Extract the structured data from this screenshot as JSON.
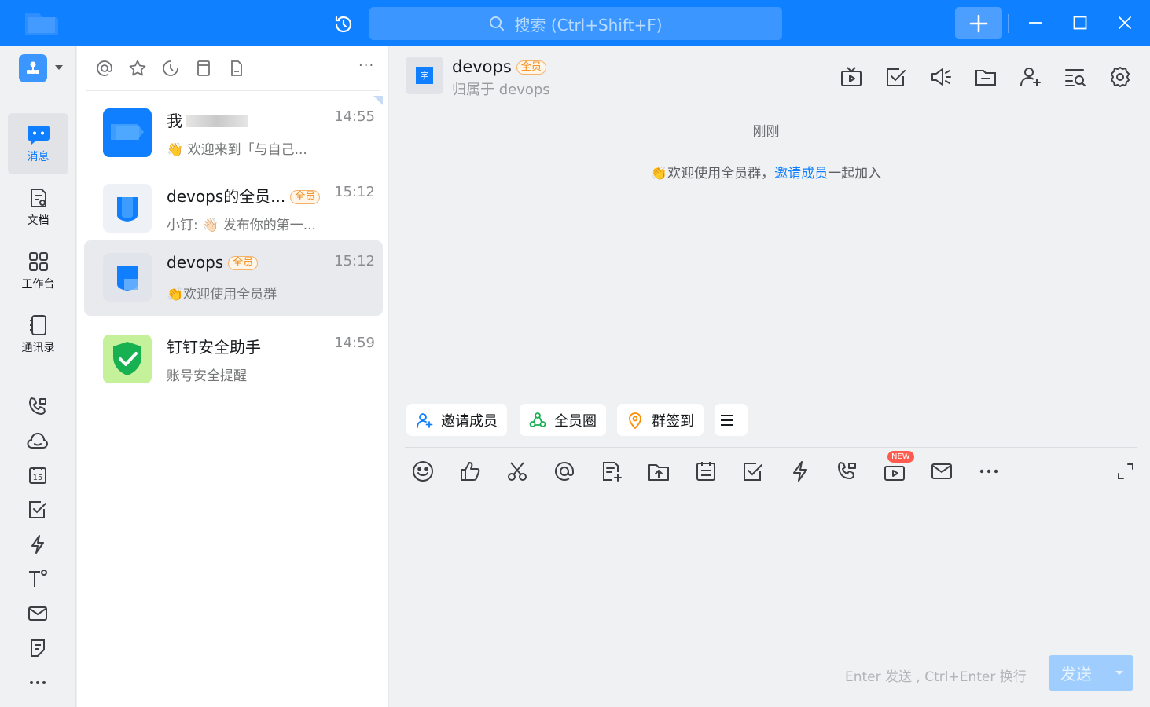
{
  "titlebar": {
    "search_placeholder": "搜索 (Ctrl+Shift+F)",
    "icons": [
      "app-logo",
      "history-icon",
      "search-icon",
      "plus-icon",
      "minimize-icon",
      "maximize-icon",
      "close-icon"
    ],
    "accent_color": "#0f80ff"
  },
  "nav": {
    "items": [
      {
        "label": "消息",
        "icon": "message-icon",
        "active": true
      },
      {
        "label": "文档",
        "icon": "document-icon",
        "active": false
      },
      {
        "label": "工作台",
        "icon": "workbench-icon",
        "active": false
      },
      {
        "label": "通讯录",
        "icon": "contacts-icon",
        "active": false
      }
    ],
    "secondary_icons": [
      "phone-icon",
      "cloud-icon",
      "calendar-icon",
      "todo-icon",
      "flash-icon",
      "text-tool-icon",
      "mail-icon",
      "notes-icon",
      "more-icon"
    ],
    "calendar_day": "15"
  },
  "list": {
    "filter_icons": [
      "at-icon",
      "star-icon",
      "clock-icon",
      "bookmark-icon",
      "file-icon"
    ],
    "more": "···",
    "conversations": [
      {
        "name": "我",
        "preview": "👋 欢迎来到「与自己...",
        "time": "14:55",
        "tag": "",
        "selected": false
      },
      {
        "name": "devops的全员...",
        "preview": "小钉: 👋🏻 发布你的第一...",
        "time": "15:12",
        "tag": "全员",
        "selected": false
      },
      {
        "name": "devops",
        "preview": "👏欢迎使用全员群",
        "time": "15:12",
        "tag": "全员",
        "selected": true
      },
      {
        "name": "钉钉安全助手",
        "preview": "账号安全提醒",
        "time": "14:59",
        "tag": "",
        "selected": false
      }
    ]
  },
  "chat": {
    "title": "devops",
    "tag": "全员",
    "subtitle": "归属于 devops",
    "group_avatar_char": "字",
    "header_icons": [
      "live-icon",
      "task-icon",
      "announcement-icon",
      "folder-icon",
      "add-member-icon",
      "search-history-icon",
      "settings-icon"
    ],
    "timestamp": "刚刚",
    "system_message": {
      "prefix": "👏欢迎使用全员群，",
      "link": "邀请成员",
      "suffix": "一起加入"
    },
    "quick_actions": [
      {
        "label": "邀请成员",
        "icon": "invite-icon"
      },
      {
        "label": "全员圈",
        "icon": "circle-icon"
      },
      {
        "label": "群签到",
        "icon": "checkin-icon"
      }
    ],
    "toolbar_icons": [
      "emoji-icon",
      "thumbs-up-icon",
      "scissors-icon",
      "at-icon",
      "doc-add-icon",
      "upload-icon",
      "calendar-icon",
      "todo-icon",
      "flash-icon",
      "phone-icon",
      "live-icon",
      "mail-icon",
      "more-icon",
      "expand-icon"
    ],
    "new_badge": "NEW",
    "input_hint": "Enter 发送 , Ctrl+Enter 换行",
    "send_label": "发送"
  }
}
